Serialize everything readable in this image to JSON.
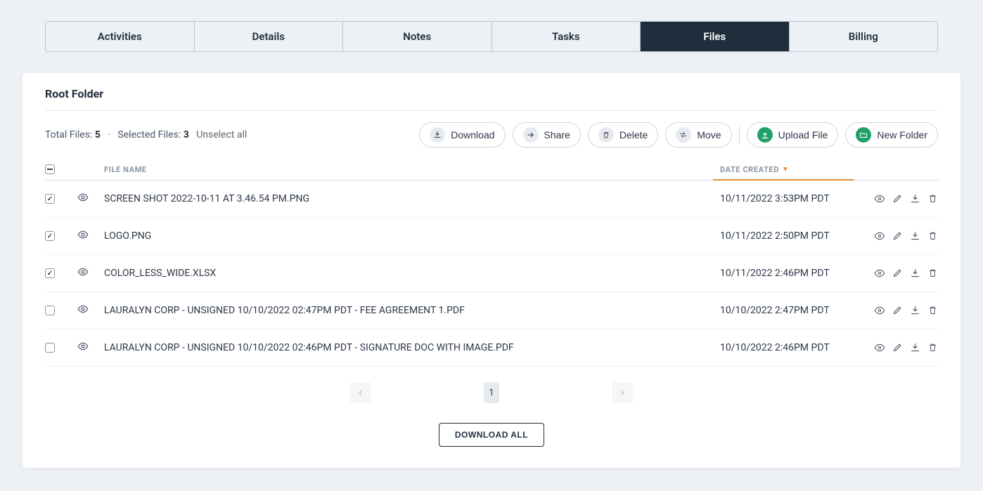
{
  "tabs": [
    {
      "label": "Activities",
      "active": false
    },
    {
      "label": "Details",
      "active": false
    },
    {
      "label": "Notes",
      "active": false
    },
    {
      "label": "Tasks",
      "active": false
    },
    {
      "label": "Files",
      "active": true
    },
    {
      "label": "Billing",
      "active": false
    }
  ],
  "folder_title": "Root Folder",
  "stats": {
    "total_label": "Total Files:",
    "total_value": "5",
    "separator": "·",
    "selected_label": "Selected Files:",
    "selected_value": "3",
    "unselect_label": "Unselect all"
  },
  "actions": {
    "download": "Download",
    "share": "Share",
    "delete": "Delete",
    "move": "Move",
    "upload": "Upload File",
    "new_folder": "New Folder"
  },
  "columns": {
    "filename": "FILE NAME",
    "date": "DATE CREATED"
  },
  "rows": [
    {
      "checked": true,
      "name": "Screen Shot 2022-10-11 at 3.46.54 PM.png",
      "date": "10/11/2022 3:53pm PDT"
    },
    {
      "checked": true,
      "name": "logo.png",
      "date": "10/11/2022 2:50pm PDT"
    },
    {
      "checked": true,
      "name": "color_less_wide.xlsx",
      "date": "10/11/2022 2:46pm PDT"
    },
    {
      "checked": false,
      "name": "Lauralyn Corp - Unsigned 10/10/2022 02:47pm PDT - fee agreement 1.pdf",
      "date": "10/10/2022 2:47pm PDT"
    },
    {
      "checked": false,
      "name": "Lauralyn Corp - Unsigned 10/10/2022 02:46pm PDT - Signature doc with image.pdf",
      "date": "10/10/2022 2:46pm PDT"
    }
  ],
  "pagination": {
    "current": "1"
  },
  "download_all_label": "DOWNLOAD ALL"
}
